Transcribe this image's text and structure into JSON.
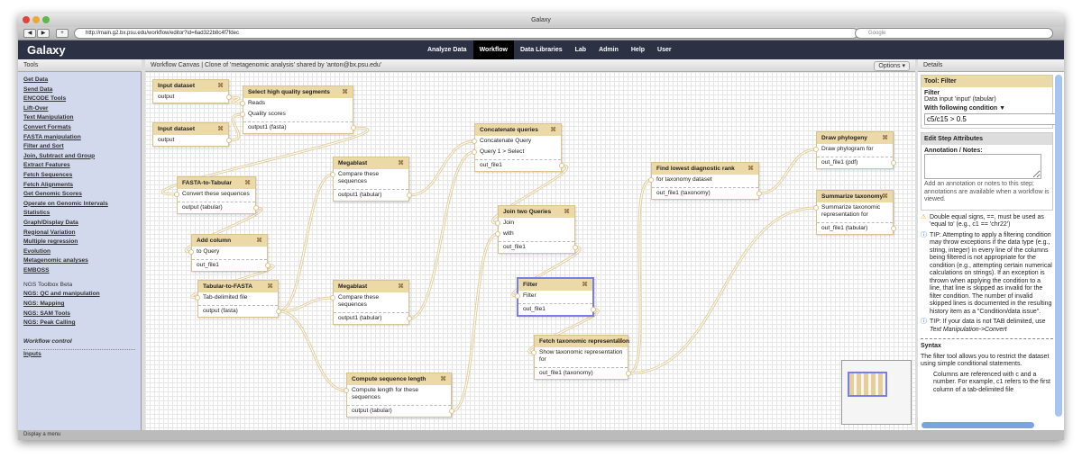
{
  "window": {
    "title": "Galaxy",
    "url": "http://main.g2.bx.psu.edu/workflow/editor?id=6ad322b8c4f7fdec",
    "search_placeholder": "Google"
  },
  "header": {
    "brand": "Galaxy",
    "nav": [
      "Analyze Data",
      "Workflow",
      "Data Libraries",
      "Lab",
      "Admin",
      "Help",
      "User"
    ],
    "active": "Workflow"
  },
  "tools": {
    "title": "Tools",
    "items": [
      "Get Data",
      "Send Data",
      "ENCODE Tools",
      "Lift-Over",
      "Text Manipulation",
      "Convert Formats",
      "FASTA manipulation",
      "Filter and Sort",
      "Join, Subtract and Group",
      "Extract Features",
      "Fetch Sequences",
      "Fetch Alignments",
      "Get Genomic Scores",
      "Operate on Genomic Intervals",
      "Statistics",
      "Graph/Display Data",
      "Regional Variation",
      "Multiple regression",
      "Evolution",
      "Metagenomic analyses",
      "EMBOSS"
    ],
    "ngs_section": "NGS Toolbox Beta",
    "ngs_items": [
      "NGS: QC and manipulation",
      "NGS: Mapping",
      "NGS: SAM Tools",
      "NGS: Peak Calling"
    ],
    "workflow_control": "Workflow control",
    "wc_items": [
      "Inputs"
    ]
  },
  "canvas": {
    "title": "Workflow Canvas | Clone of 'metagenomic analysis' shared by 'anton@bx.psu.edu'",
    "options_label": "Options ▾"
  },
  "nodes": [
    {
      "title": "Input dataset",
      "inputs": [],
      "output": "output"
    },
    {
      "title": "Input dataset",
      "inputs": [],
      "output": "output"
    },
    {
      "title": "Select high quality segments",
      "inputs": [
        "Reads",
        "Quality scores"
      ],
      "output": "output1 (fasta)"
    },
    {
      "title": "FASTA-to-Tabular",
      "inputs": [
        "Convert these sequences"
      ],
      "output": "output (tabular)"
    },
    {
      "title": "Add column",
      "inputs": [
        "to Query"
      ],
      "output": "out_file1"
    },
    {
      "title": "Tabular-to-FASTA",
      "inputs": [
        "Tab-delimited file"
      ],
      "output": "output (fasta)"
    },
    {
      "title": "Megablast",
      "inputs": [
        "Compare these sequences"
      ],
      "output": "output1 (tabular)"
    },
    {
      "title": "Megablast",
      "inputs": [
        "Compare these sequences"
      ],
      "output": "output1 (tabular)"
    },
    {
      "title": "Compute sequence length",
      "inputs": [
        "Compute length for these sequences"
      ],
      "output": "output (tabular)"
    },
    {
      "title": "Concatenate queries",
      "inputs": [
        "Concatenate Query",
        "Query 1 > Select"
      ],
      "output": "out_file1"
    },
    {
      "title": "Join two Queries",
      "inputs": [
        "Join",
        "with"
      ],
      "output": "out_file1"
    },
    {
      "title": "Filter",
      "inputs": [
        "Filter"
      ],
      "output": "out_file1",
      "selected": true
    },
    {
      "title": "Fetch taxonomic representation",
      "inputs": [
        "Show taxonomic representation for"
      ],
      "output": "out_file1 (taxonomy)"
    },
    {
      "title": "Find lowest diagnostic rank",
      "inputs": [
        "for taxonomy dataset"
      ],
      "output": "out_file1 (taxonomy)"
    },
    {
      "title": "Draw phylogeny",
      "inputs": [
        "Draw phylogram for"
      ],
      "output": "out_file1 (pdf)"
    },
    {
      "title": "Summarize taxonomy",
      "inputs": [
        "Summarize taxonomic representation for"
      ],
      "output": "out_file1 (tabular)"
    }
  ],
  "connections": [
    [
      0,
      2,
      0
    ],
    [
      1,
      2,
      1
    ],
    [
      2,
      3,
      0
    ],
    [
      3,
      4,
      0
    ],
    [
      4,
      5,
      0
    ],
    [
      5,
      6,
      0
    ],
    [
      5,
      7,
      0
    ],
    [
      5,
      8,
      0
    ],
    [
      6,
      9,
      0
    ],
    [
      7,
      9,
      1
    ],
    [
      9,
      10,
      0
    ],
    [
      8,
      10,
      1
    ],
    [
      10,
      11,
      0
    ],
    [
      11,
      12,
      0
    ],
    [
      12,
      13,
      0
    ],
    [
      13,
      14,
      0
    ],
    [
      12,
      15,
      0
    ]
  ],
  "details": {
    "title": "Details",
    "tool_label": "Tool: Filter",
    "tool_name": "Filter",
    "data_input": "Data input 'input' (tabular)",
    "condition_label": "With following condition ▼",
    "condition_value": "c5/c15 > 0.5",
    "edit_title": "Edit Step Attributes",
    "annotation_label": "Annotation / Notes:",
    "annotation_help": "Add an annotation or notes to this step; annotations are available when a workflow is viewed.",
    "warning": "Double equal signs, ==, must be used as 'equal to' (e.g., c1 == 'chr22')",
    "tip1": "TIP: Attempting to apply a filtering condition may throw exceptions if the data type (e.g., string, integer) in every line of the columns being filtered is not appropriate for the condition (e.g., attempting certain numerical calculations on strings). If an exception is thrown when applying the condition to a line, that line is skipped as invalid for the filter condition. The number of invalid skipped lines is documented in the resulting history item as a \"Condition/data issue\".",
    "tip2": "TIP: If your data is not TAB delimited, use",
    "tip2_link": "Text Manipulation->Convert",
    "syntax_title": "Syntax",
    "syntax_text": "The filter tool allows you to restrict the dataset using simple conditional statements.",
    "bullet": "Columns are referenced with c and a number. For example, c1 refers to the first column of a tab-delimited file"
  },
  "status": "Display a menu"
}
